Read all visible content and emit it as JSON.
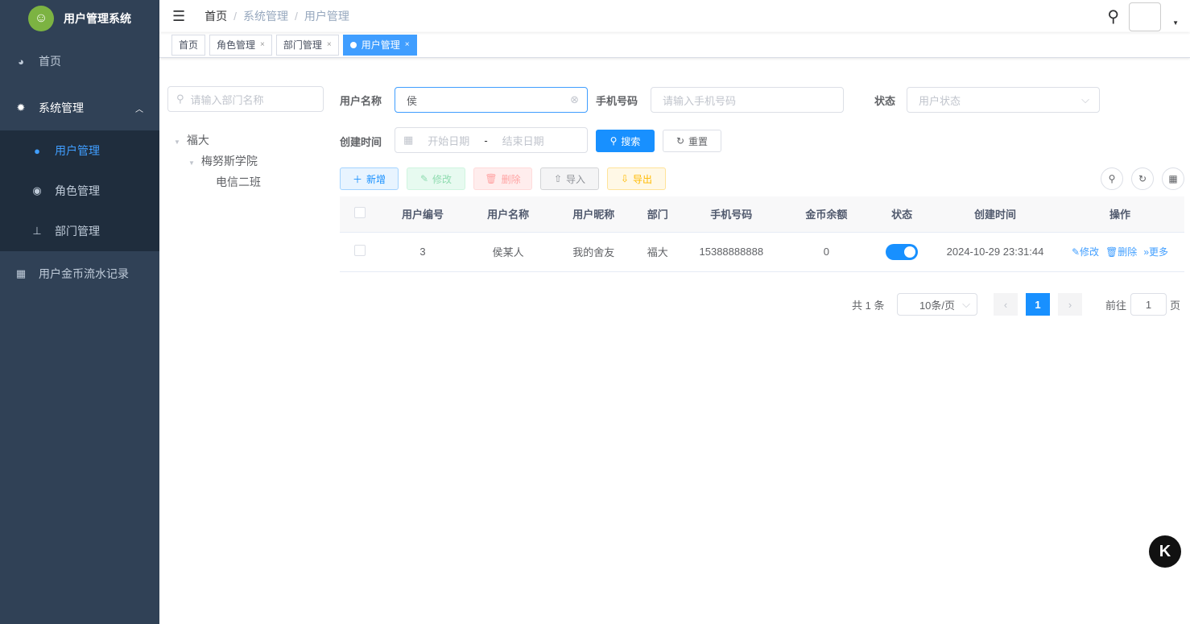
{
  "app": {
    "title": "用户管理系统"
  },
  "sidebar": {
    "items": [
      {
        "label": "首页",
        "icon": "dashboard-icon"
      },
      {
        "label": "系统管理",
        "icon": "gear-icon"
      },
      {
        "label": "用户管理",
        "icon": "user-icon"
      },
      {
        "label": "角色管理",
        "icon": "users-icon"
      },
      {
        "label": "部门管理",
        "icon": "tree-icon"
      },
      {
        "label": "用户金币流水记录",
        "icon": "table-icon"
      }
    ]
  },
  "breadcrumb": [
    "首页",
    "系统管理",
    "用户管理"
  ],
  "tabs": [
    {
      "label": "首页"
    },
    {
      "label": "角色管理"
    },
    {
      "label": "部门管理"
    },
    {
      "label": "用户管理"
    }
  ],
  "tab_close": "×",
  "dept": {
    "placeholder": "请输入部门名称",
    "tree": [
      "福大",
      "梅努斯学院",
      "电信二班"
    ]
  },
  "search": {
    "username_label": "用户名称",
    "username_value": "侯",
    "phone_label": "手机号码",
    "phone_placeholder": "请输入手机号码",
    "status_label": "状态",
    "status_placeholder": "用户状态",
    "time_label": "创建时间",
    "start_placeholder": "开始日期",
    "range_sep": "-",
    "end_placeholder": "结束日期",
    "search_btn": "搜索",
    "reset_btn": "重置"
  },
  "toolbar": {
    "add": "新增",
    "edit": "修改",
    "delete": "删除",
    "import": "导入",
    "export": "导出"
  },
  "table": {
    "headers": [
      "用户编号",
      "用户名称",
      "用户昵称",
      "部门",
      "手机号码",
      "金币余额",
      "状态",
      "创建时间",
      "操作"
    ],
    "rows": [
      {
        "id": "3",
        "name": "侯某人",
        "nick": "我的舍友",
        "dept": "福大",
        "phone": "15388888888",
        "coins": "0",
        "status_on": true,
        "created": "2024-10-29 23:31:44"
      }
    ],
    "ops": {
      "edit": "修改",
      "delete": "删除",
      "more": "更多"
    }
  },
  "pagination": {
    "total": "共 1 条",
    "page_size": "10条/页",
    "current": "1",
    "goto_label": "前往",
    "goto_value": "1",
    "page_suffix": "页"
  },
  "colors": {
    "primary": "#1890ff",
    "sidebar": "#304156"
  }
}
